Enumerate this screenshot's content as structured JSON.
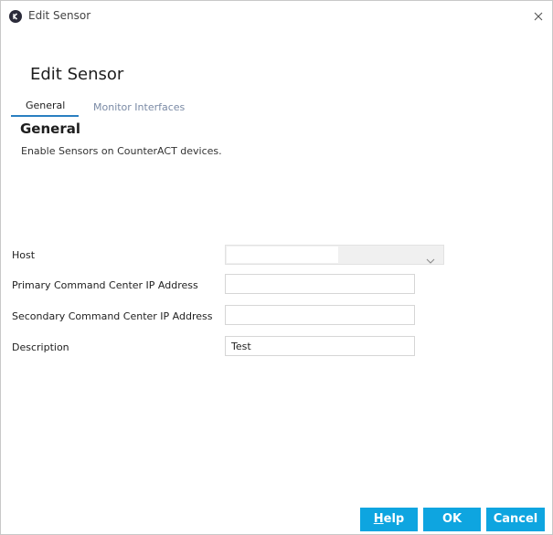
{
  "window": {
    "title": "Edit Sensor",
    "icon": "app-logo-icon",
    "close_icon": "close-icon"
  },
  "dialog": {
    "heading": "Edit Sensor"
  },
  "tabs": [
    {
      "label": "General",
      "active": true
    },
    {
      "label": "Monitor Interfaces",
      "active": false
    }
  ],
  "section": {
    "title": "General",
    "description": "Enable Sensors on CounterACT devices."
  },
  "form": {
    "host_label": "Host",
    "host_value": "",
    "primary_label": "Primary Command Center IP Address",
    "primary_value": "",
    "secondary_label": "Secondary Command Center IP Address",
    "secondary_value": "",
    "description_label": "Description",
    "description_value": "Test"
  },
  "buttons": {
    "help_mnemonic": "H",
    "help_rest": "elp",
    "ok": "OK",
    "cancel": "Cancel"
  },
  "colors": {
    "accent": "#0ea5e0",
    "tab_underline": "#2a7fc1",
    "inactive_tab": "#7a8aa5"
  }
}
